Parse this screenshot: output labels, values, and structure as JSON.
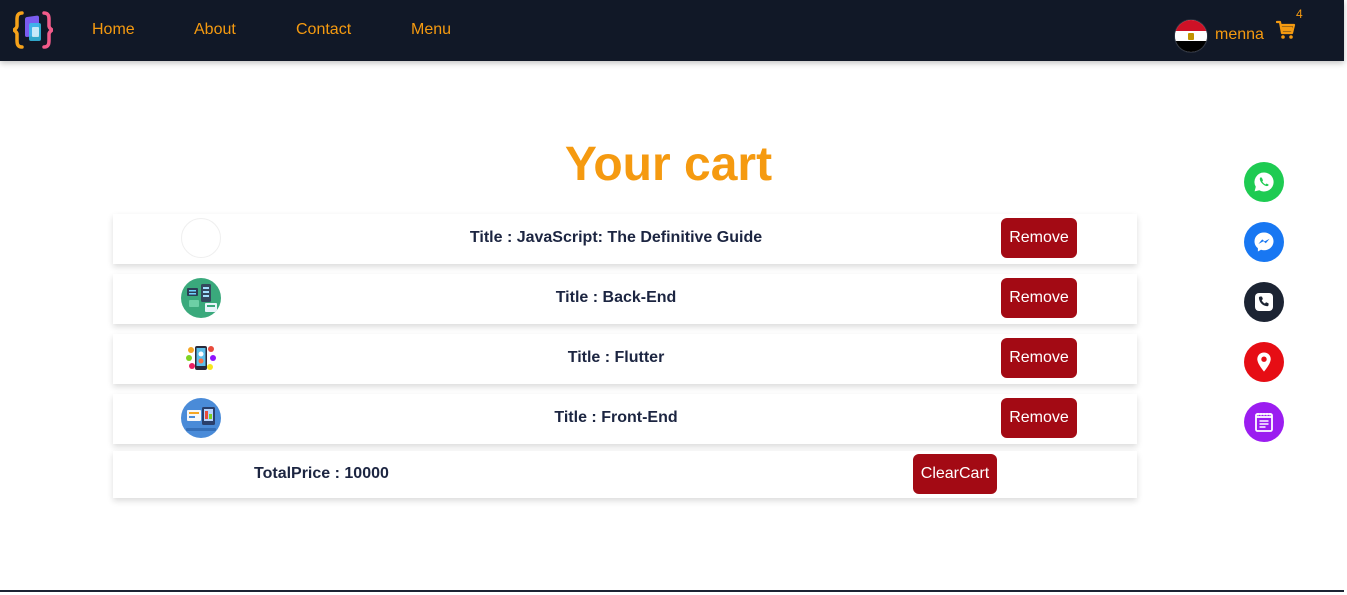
{
  "navbar": {
    "links": [
      {
        "label": "Home"
      },
      {
        "label": "About"
      },
      {
        "label": "Contact"
      },
      {
        "label": "Menu"
      }
    ],
    "username": "menna",
    "cart_count": "4",
    "flag_icon": "egypt-flag-icon",
    "cart_icon": "shopping-cart-icon"
  },
  "page": {
    "title": "Your cart"
  },
  "cart": {
    "items": [
      {
        "title": "Title : JavaScript: The Definitive Guide",
        "remove_label": "Remove",
        "thumb_icon": "blank-image"
      },
      {
        "title": "Title : Back-End",
        "remove_label": "Remove",
        "thumb_icon": "backend-illustration"
      },
      {
        "title": "Title : Flutter",
        "remove_label": "Remove",
        "thumb_icon": "flutter-apps-illustration"
      },
      {
        "title": "Title : Front-End",
        "remove_label": "Remove",
        "thumb_icon": "frontend-illustration"
      }
    ],
    "total_label": "TotalPrice : 10000",
    "clear_label": "ClearCart"
  },
  "floating_buttons": [
    {
      "icon": "whatsapp-icon",
      "color": "#1ecb52"
    },
    {
      "icon": "messenger-icon",
      "color": "#1877f2"
    },
    {
      "icon": "phone-icon",
      "color": "#1c2433"
    },
    {
      "icon": "location-pin-icon",
      "color": "#e60d14"
    },
    {
      "icon": "notes-icon",
      "color": "#9b1df0"
    }
  ],
  "colors": {
    "navbar_bg": "#111827",
    "accent": "#f59a10",
    "button": "#a30a14",
    "text_dark": "#1c2541"
  }
}
